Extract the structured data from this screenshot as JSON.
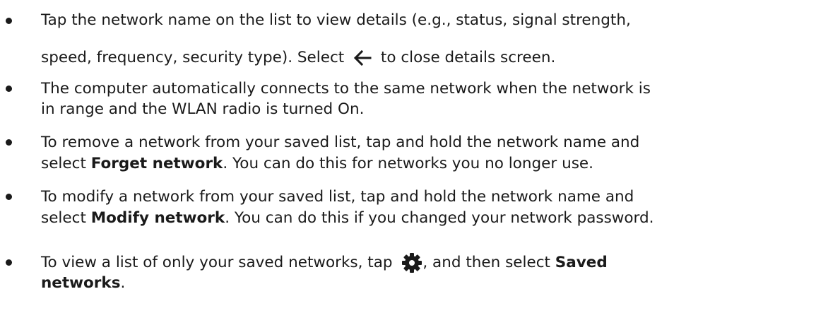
{
  "bullets": [
    {
      "line1": "Tap the network name on the list to view details (e.g., status, signal strength,",
      "line2_before": "speed, frequency, security type). Select",
      "line2_icon": "back-arrow-icon",
      "line2_after": "to close details screen."
    },
    {
      "line1": "The computer automatically connects to the same network when the network is",
      "line2": "in range and the WLAN radio is turned On."
    },
    {
      "line1": "To remove a network from your saved list, tap and hold the network name and",
      "line2_before": "select ",
      "line2_bold": "Forget network",
      "line2_after": ". You can do this for networks you no longer use."
    },
    {
      "line1": "To modify a network from your saved list, tap and hold the network name and",
      "line2_before": "select ",
      "line2_bold": "Modify network",
      "line2_after": ". You can do this if you changed your network password."
    },
    {
      "line1_before": "To view a list of only your saved networks, tap",
      "line1_icon": "gear-icon",
      "line1_after": ", and then select ",
      "line1_bold": "Saved",
      "line2_bold": "networks",
      "line2_after": "."
    }
  ]
}
